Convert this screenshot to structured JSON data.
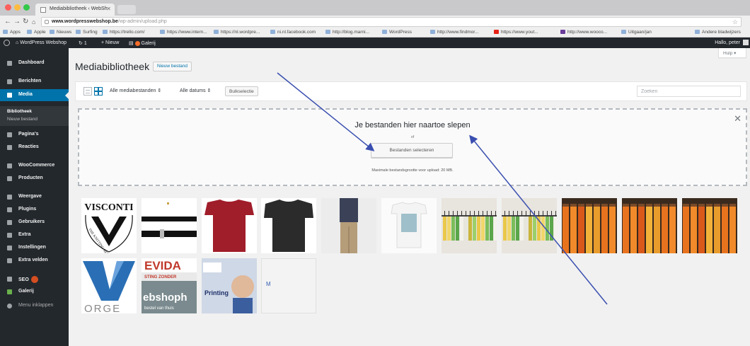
{
  "browser": {
    "tab_title": "Mediabibliotheek ‹ WebSh",
    "url_host": "www.wordpresswebshop.be",
    "url_path": "/wp-admin/upload.php",
    "bookmarks": [
      "Apps",
      "Apple",
      "Nieuws",
      "Surfing",
      "https://trello.com/",
      "https://www.intern...",
      "https://nl.wordpre...",
      "ni.nl.facebook.com",
      "http://blog.marni...",
      "WordPress",
      "http://www.findmor...",
      "https://www.yout...",
      "http://www.wooco...",
      "Uitgaan/jan",
      "Andere bladwijzers"
    ]
  },
  "adminbar": {
    "site_name": "WordPress Webshop",
    "updates": "1",
    "new_label": "+ Nieuw",
    "gallery_label": "Galerij",
    "greeting": "Hallo, peter"
  },
  "sidebar": {
    "items": [
      {
        "label": "Dashboard"
      },
      {
        "label": "Berichten"
      },
      {
        "label": "Media"
      },
      {
        "label": "Pagina's"
      },
      {
        "label": "Reacties"
      },
      {
        "label": "WooCommerce"
      },
      {
        "label": "Producten"
      },
      {
        "label": "Weergave"
      },
      {
        "label": "Plugins"
      },
      {
        "label": "Gebruikers"
      },
      {
        "label": "Extra"
      },
      {
        "label": "Instellingen"
      },
      {
        "label": "Extra velden"
      },
      {
        "label": "SEO"
      },
      {
        "label": "Galerij"
      },
      {
        "label": "Menu inklappen"
      }
    ],
    "submenu": {
      "active": "Bibliotheek",
      "add_new": "Nieuw bestand"
    }
  },
  "main": {
    "title": "Mediabibliotheek",
    "add_new_label": "Nieuw bestand",
    "help_label": "Hulp ▾",
    "filter_type": "Alle mediabestanden ⇕",
    "filter_date": "Alle datums ⇕",
    "bulk_select_label": "Bulkselectie",
    "search_placeholder": "Zoeken",
    "dropzone": {
      "title": "Je bestanden hier naartoe slepen",
      "or": "of",
      "select_button": "Bestanden selecteren",
      "max_size": "Maximale bestandsgrootte voor upload: 20 MB."
    }
  },
  "thumbnails": {
    "logo_text": "VISCONTI",
    "logo_ring": "THE KNITTING RENAISSANCE",
    "evida_text": "EVIDA",
    "evida_sub": "STING ZONDER",
    "webshop_text": "ebshoph",
    "webshop_sub": "bestel van thuis",
    "printing_text": "Printing",
    "orge_text": "ORGE",
    "icon_text": "M"
  },
  "colors": {
    "admin_dark": "#23282d",
    "admin_blue": "#0073aa",
    "arrow": "#3a4fb0"
  }
}
